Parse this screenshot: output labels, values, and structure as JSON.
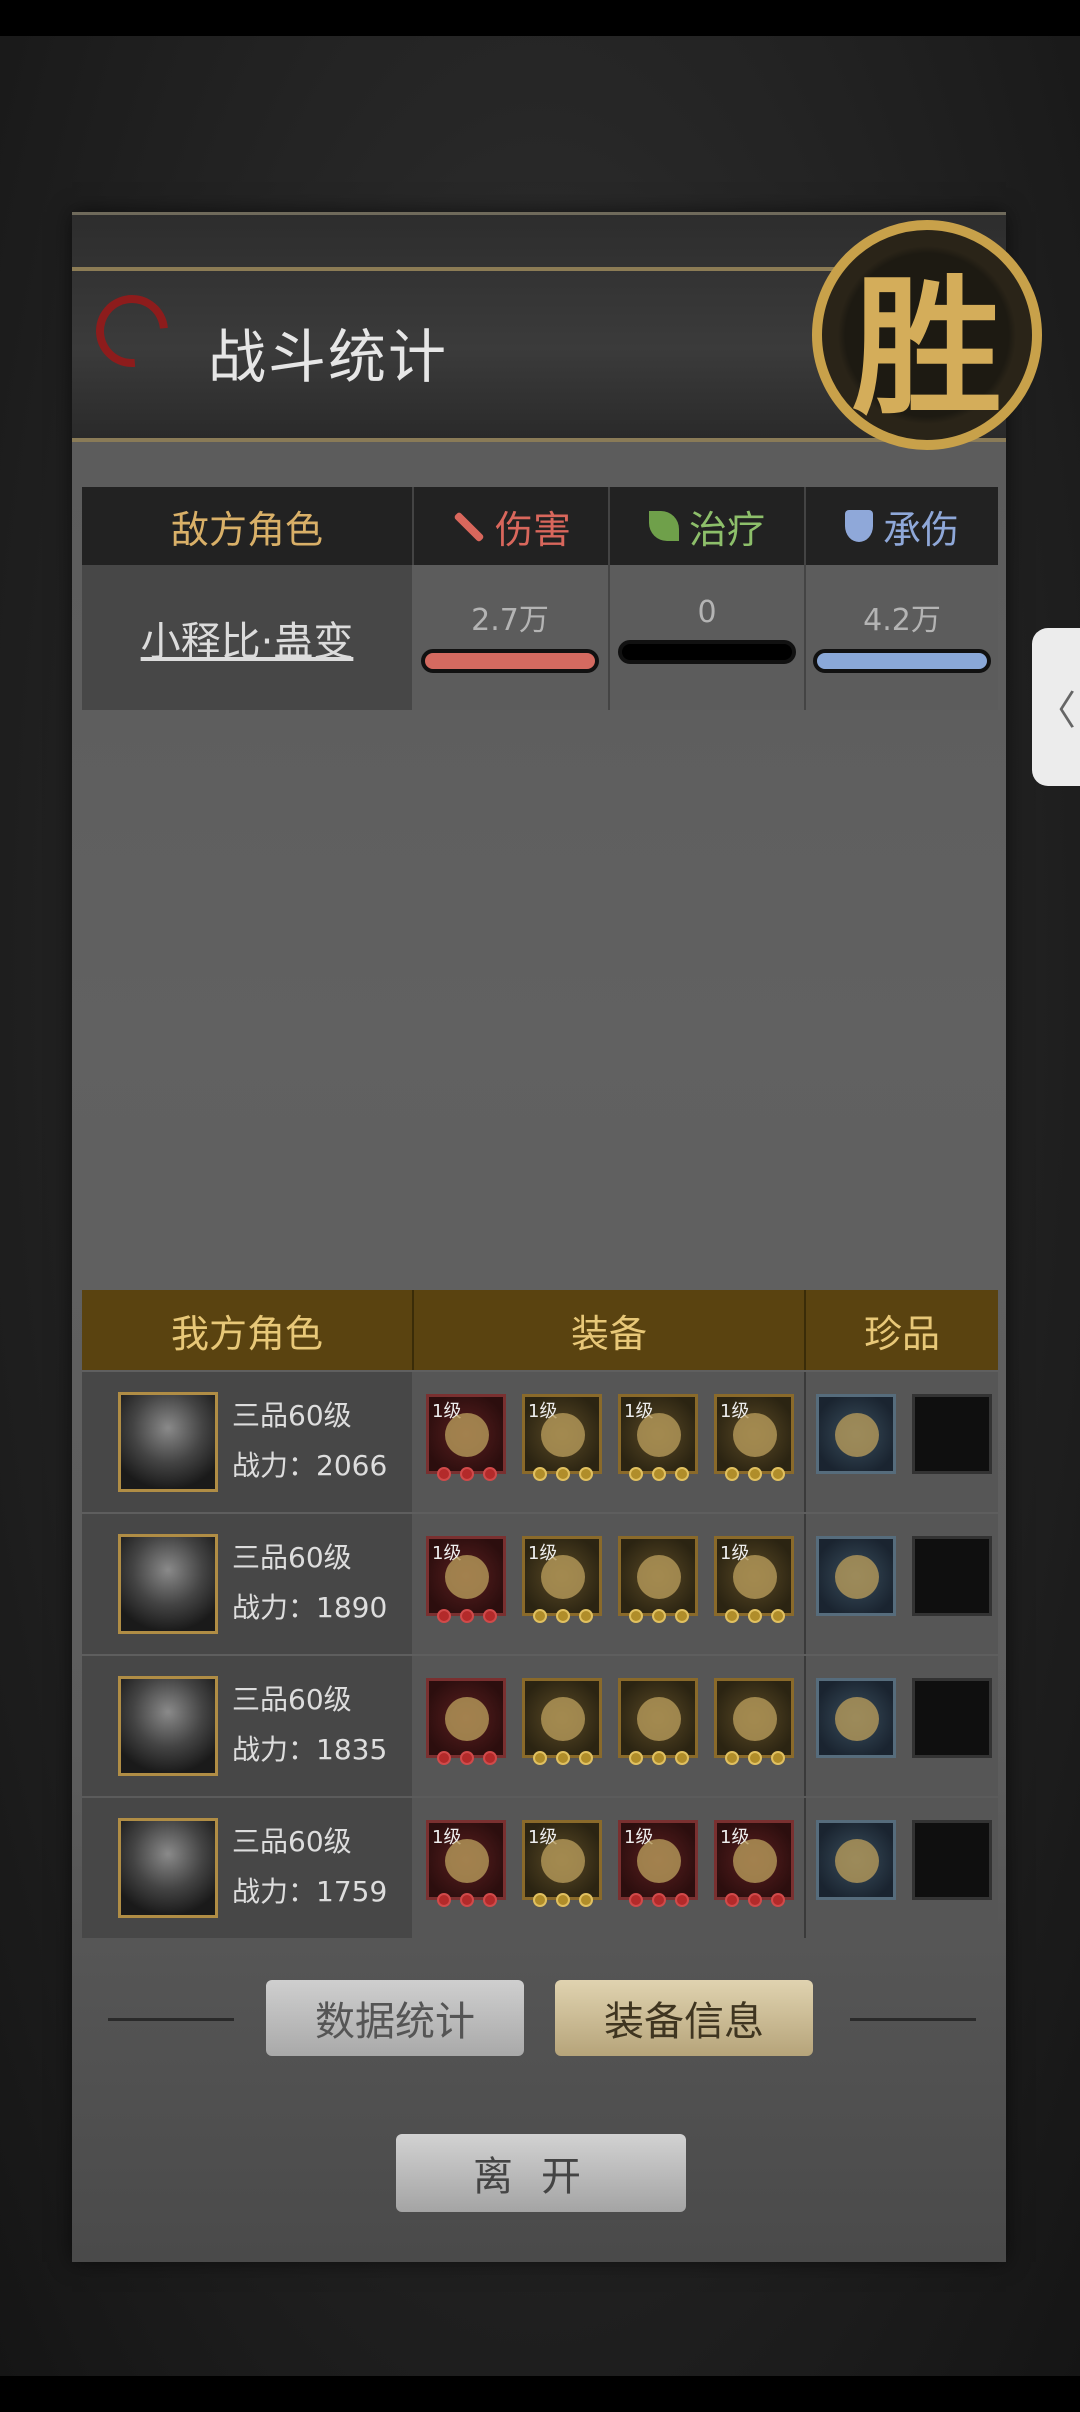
{
  "header": {
    "title": "战斗统计",
    "seal": "胜"
  },
  "enemy": {
    "headers": [
      "敌方角色",
      "伤害",
      "治疗",
      "承伤"
    ],
    "row": {
      "name": "小释比·蛊变",
      "damage": "2.7万",
      "heal": "0",
      "taken": "4.2万"
    },
    "bar_colors": {
      "damage": "#d46a60",
      "heal": "#000000",
      "taken": "#8aa8d8"
    }
  },
  "ours": {
    "headers": [
      "我方角色",
      "装备",
      "珍品"
    ],
    "heroes": [
      {
        "rank": "三品60级",
        "power": "战力：2066",
        "equip": [
          "1级",
          "1级",
          "1级",
          "1级"
        ]
      },
      {
        "rank": "三品60级",
        "power": "战力：1890",
        "equip": [
          "1级",
          "1级",
          "",
          "1级"
        ]
      },
      {
        "rank": "三品60级",
        "power": "战力：1835",
        "equip": [
          "",
          "",
          "",
          ""
        ]
      },
      {
        "rank": "三品60级",
        "power": "战力：1759",
        "equip": [
          "1级",
          "1级",
          "1级",
          "1级"
        ]
      }
    ]
  },
  "buttons": {
    "stats": "数据统计",
    "equip": "装备信息",
    "leave": "离开"
  },
  "side_tab": "〈"
}
